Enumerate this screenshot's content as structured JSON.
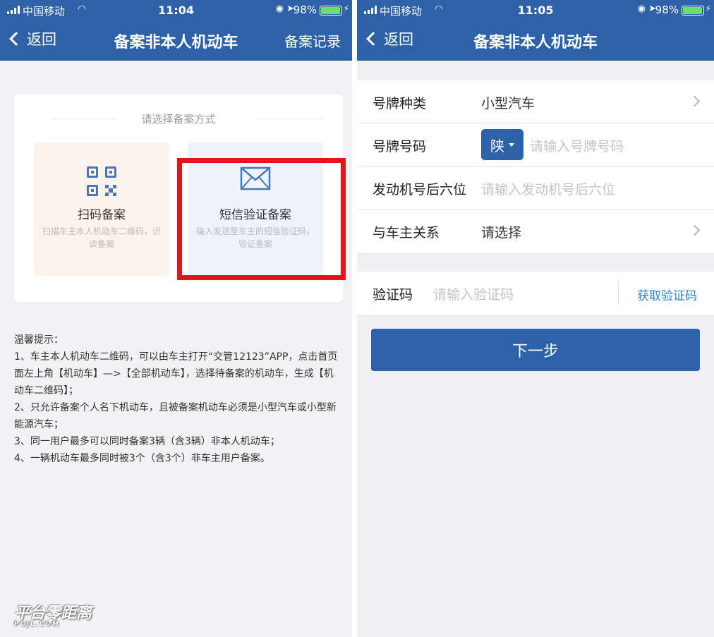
{
  "left": {
    "status": {
      "carrier": "中国移动",
      "time": "11:04",
      "battery": "98%",
      "battery_level": 0.98
    },
    "nav": {
      "back": "返回",
      "title": "备案非本人机动车",
      "action": "备案记录"
    },
    "card": {
      "caption": "请选择备案方式",
      "options": [
        {
          "name": "扫码备案",
          "desc": "扫描车主本人机动车二维码，识读备案"
        },
        {
          "name": "短信验证备案",
          "desc": "输入发送至车主的短信验证码，验证备案"
        }
      ]
    },
    "tips": [
      "温馨提示：",
      "1、车主本人机动车二维码，可以由车主打开“交管12123”APP，点击首页面左上角【机动车】—>【全部机动车】，选择待备案的机动车，生成【机动车二维码】；",
      "2、只允许备案个人名下机动车，且被备案机动车必须是小型汽车或小型新能源汽车；",
      "3、同一用户最多可以同时备案3辆（含3辆）非本人机动车；",
      "4、一辆机动车最多同时被3个（含3个）非车主用户备案。"
    ],
    "watermark": {
      "main": "平台零距离",
      "sub": "PCJL.COM"
    }
  },
  "right": {
    "status": {
      "carrier": "中国移动",
      "time": "11:05",
      "battery": "98%",
      "battery_level": 0.98
    },
    "nav": {
      "back": "返回",
      "title": "备案非本人机动车"
    },
    "form": {
      "plate_type": {
        "label": "号牌种类",
        "value": "小型汽车"
      },
      "plate_no": {
        "label": "号牌号码",
        "province": "陕",
        "placeholder": "请输入号牌号码"
      },
      "engine": {
        "label": "发动机号后六位",
        "placeholder": "请输入发动机号后六位"
      },
      "relation": {
        "label": "与车主关系",
        "value": "请选择"
      }
    },
    "verify": {
      "label": "验证码",
      "placeholder": "请输入验证码",
      "get_code": "获取验证码"
    },
    "next": "下一步"
  },
  "colors": {
    "brand": "#2d62a8",
    "highlight": "#e3151b",
    "link": "#2d7fd0"
  }
}
